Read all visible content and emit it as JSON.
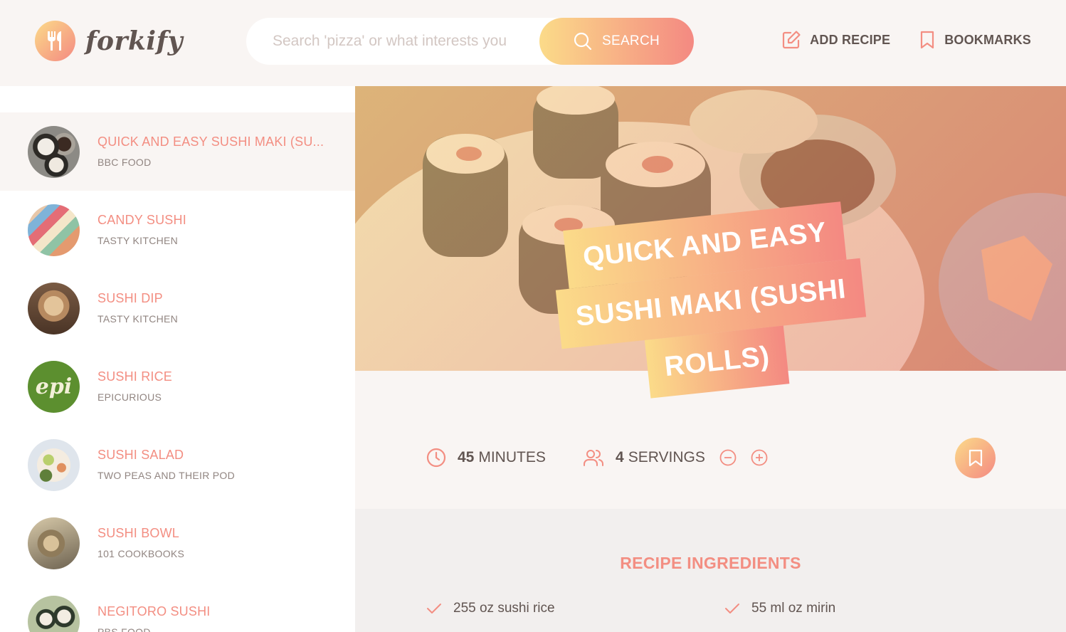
{
  "app": {
    "name": "forkify"
  },
  "search": {
    "placeholder": "Search 'pizza' or what interests you",
    "button_label": "SEARCH"
  },
  "nav": {
    "add_recipe_label": "ADD RECIPE",
    "bookmarks_label": "BOOKMARKS"
  },
  "results": [
    {
      "title": "QUICK AND EASY SUSHI MAKI (SU...",
      "publisher": "BBC FOOD",
      "active": true
    },
    {
      "title": "CANDY SUSHI",
      "publisher": "TASTY KITCHEN",
      "active": false
    },
    {
      "title": "SUSHI DIP",
      "publisher": "TASTY KITCHEN",
      "active": false
    },
    {
      "title": "SUSHI RICE",
      "publisher": "EPICURIOUS",
      "active": false,
      "thumb_text": "epi"
    },
    {
      "title": "SUSHI SALAD",
      "publisher": "TWO PEAS AND THEIR POD",
      "active": false
    },
    {
      "title": "SUSHI BOWL",
      "publisher": "101 COOKBOOKS",
      "active": false
    },
    {
      "title": "NEGITORO SUSHI",
      "publisher": "PBS FOOD",
      "active": false
    }
  ],
  "recipe": {
    "title_lines": [
      "QUICK AND EASY",
      "SUSHI MAKI (SUSHI",
      "ROLLS)"
    ],
    "cooking_time": "45",
    "cooking_time_unit": "MINUTES",
    "servings": "4",
    "servings_unit": "SERVINGS",
    "ingredients_heading": "RECIPE INGREDIENTS",
    "ingredients": [
      "255 oz sushi rice",
      "55 ml oz mirin"
    ]
  },
  "colors": {
    "accent": "#f38e82",
    "gradient_start": "#fbdb89",
    "gradient_end": "#f48982",
    "text": "#615551",
    "bg": "#f9f5f3"
  },
  "icons": [
    "fork-knife-icon",
    "search-icon",
    "edit-icon",
    "bookmark-icon",
    "clock-icon",
    "users-icon",
    "minus-circle-icon",
    "plus-circle-icon",
    "check-icon"
  ]
}
